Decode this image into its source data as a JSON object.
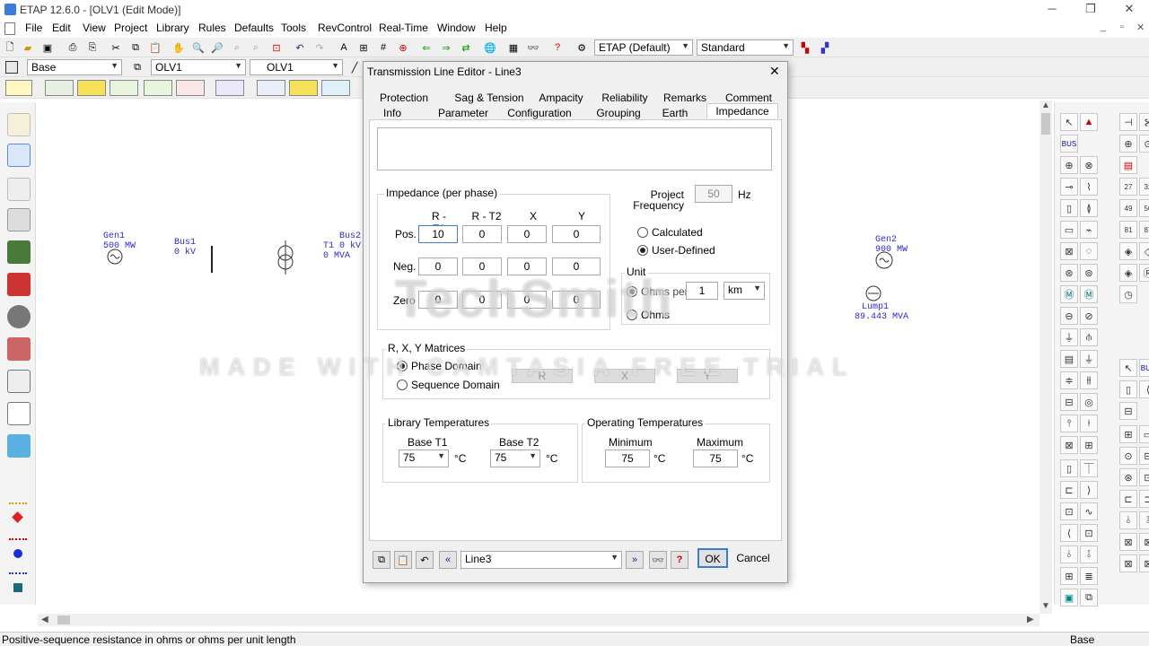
{
  "app": {
    "title": "ETAP 12.6.0 - [OLV1 (Edit Mode)]",
    "minimize": "─",
    "restore": "❐",
    "close": "✕",
    "mdi_minimize": "_",
    "mdi_restore": "▫",
    "mdi_close": "✕"
  },
  "menu": [
    "File",
    "Edit",
    "View",
    "Project",
    "Library",
    "Rules",
    "Defaults",
    "Tools",
    "RevControl",
    "Real-Time",
    "Window",
    "Help"
  ],
  "toolbar": {
    "config_combo": "ETAP (Default)",
    "standard_combo": "Standard",
    "base_combo": "Base",
    "olv_combo_1": "OLV1",
    "olv_combo_2": "OLV1"
  },
  "diagram": {
    "gen1_name": "Gen1",
    "gen1_rating": "500 MW",
    "bus1_name": "Bus1",
    "bus1_kv": "0 kV",
    "bus2_name": "Bus2",
    "t1_label": "T1 0 kV",
    "t1_mva": "0 MVA",
    "gen2_name": "Gen2",
    "gen2_rating": "900 MW",
    "lump_name": "Lump1",
    "lump_rating": "89.443 MVA"
  },
  "dialog": {
    "title": "Transmission Line Editor - Line3",
    "close": "✕",
    "tabs_row1": [
      "Protection",
      "Sag & Tension",
      "Ampacity",
      "Reliability",
      "Remarks",
      "Comment"
    ],
    "tabs_row2": [
      "Info",
      "Parameter",
      "Configuration",
      "Grouping",
      "Earth",
      "Impedance"
    ],
    "active_tab": "Impedance",
    "impedance_group": "Impedance (per phase)",
    "col_headers": [
      "R - T1",
      "R - T2",
      "X",
      "Y"
    ],
    "rows": [
      {
        "label": "Pos.",
        "values": [
          "10",
          "0",
          "0",
          "0"
        ]
      },
      {
        "label": "Neg.",
        "values": [
          "0",
          "0",
          "0",
          "0"
        ]
      },
      {
        "label": "Zero",
        "values": [
          "0",
          "0",
          "0",
          "0"
        ]
      }
    ],
    "project_frequency_label_1": "Project",
    "project_frequency_label_2": "Frequency",
    "project_frequency_value": "50",
    "hz": "Hz",
    "calculated": "Calculated",
    "user_defined": "User-Defined",
    "unit_group": "Unit",
    "ohms_per": "Ohms per",
    "ohms_per_value": "1",
    "unit_combo": "km",
    "ohms": "Ohms",
    "matrices_group": "R, X, Y Matrices",
    "phase_domain": "Phase Domain",
    "sequence_domain": "Sequence Domain",
    "matrix_buttons": [
      "R",
      "X",
      "Y"
    ],
    "lib_temps_group": "Library Temperatures",
    "base_t1": "Base T1",
    "base_t2": "Base T2",
    "base_t1_value": "75",
    "base_t2_value": "75",
    "op_temps_group": "Operating Temperatures",
    "minimum": "Minimum",
    "maximum": "Maximum",
    "min_value": "75",
    "max_value": "75",
    "deg_c": "°C",
    "element_combo": "Line3",
    "ok": "OK",
    "cancel": "Cancel",
    "help": "?"
  },
  "watermark": {
    "line1": "TechSmith",
    "line2": "MADE WITH CAMTASIA FREE TRIAL"
  },
  "status": {
    "message": "Positive-sequence resistance in ohms or ohms per unit length",
    "right": "Base"
  }
}
